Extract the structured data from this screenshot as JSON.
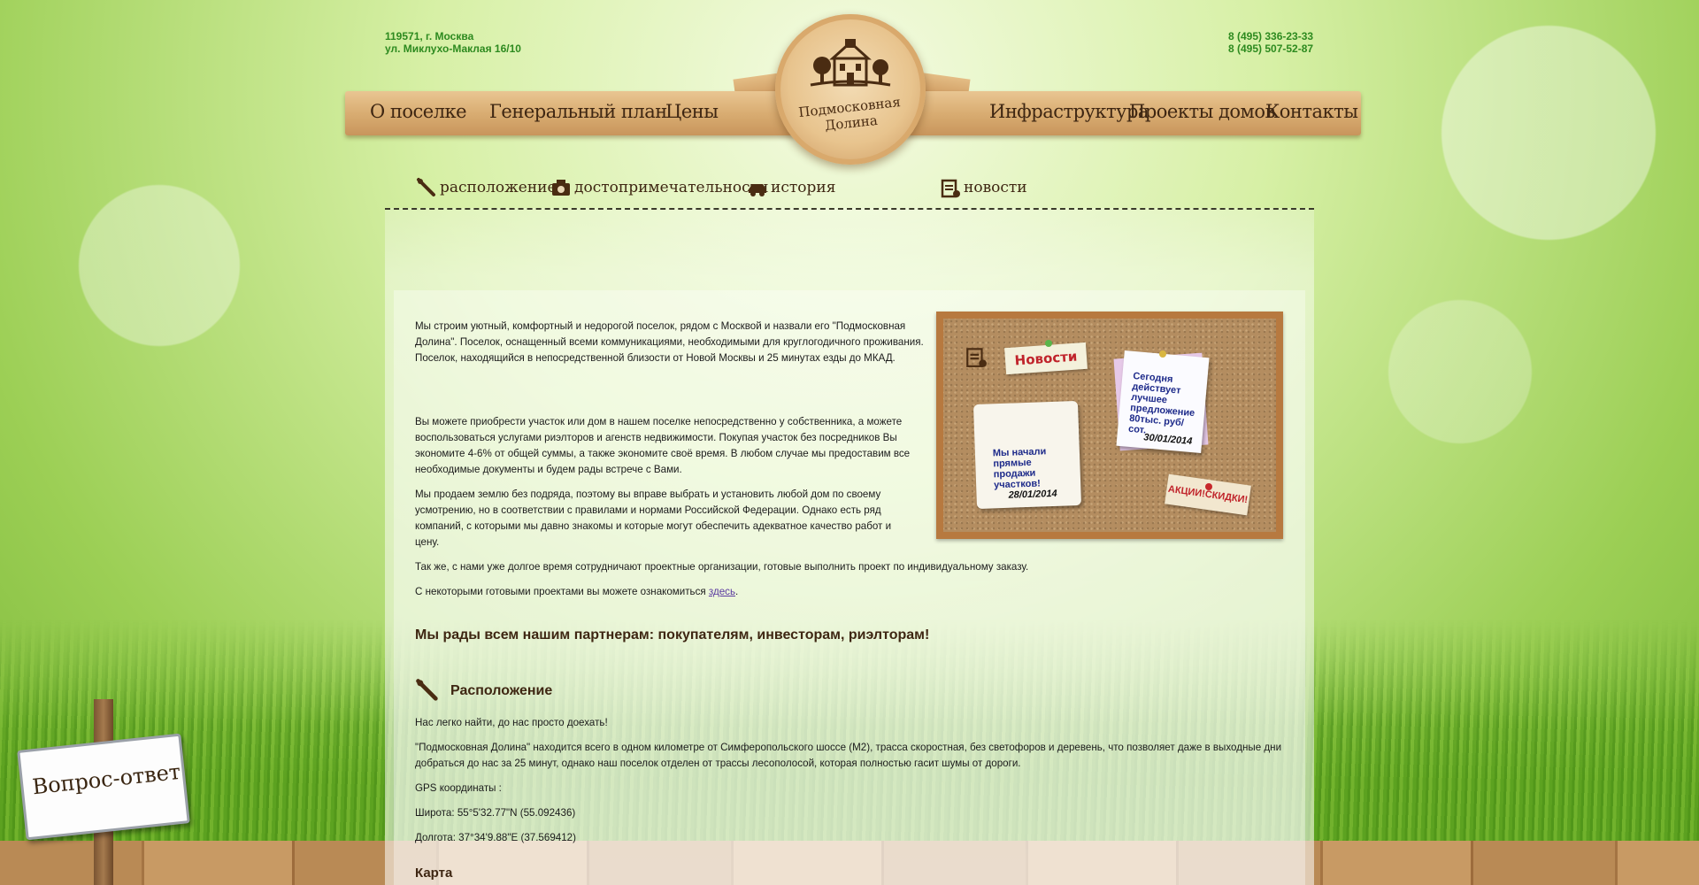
{
  "header": {
    "address_line1": "119571, г. Москва",
    "address_line2": "ул. Миклухо-Маклая 16/10",
    "phone1": "8 (495) 336-23-33",
    "phone2": "8 (495) 507-52-87",
    "logo_text": "Подмосковная Долина"
  },
  "menu": {
    "items": [
      "О поселке",
      "Генеральный план",
      "Цены",
      "Инфраструктура",
      "Проекты домов",
      "Контакты"
    ]
  },
  "submenu": {
    "items": [
      "расположение",
      "достопримечательности",
      "история",
      "новости"
    ]
  },
  "content": {
    "p1": "Мы строим уютный, комфортный и недорогой поселок, рядом с Москвой и назвали его \"Подмосковная Долина\". Поселок, оснащенный всеми коммуникациями, необходимыми для круглогодичного проживания. Поселок, находящийся в непосредственной близости от Новой Москвы и 25 минутах езды до МКАД.",
    "p2": "Вы можете приобрести участок или дом в нашем поселке непосредственно у собственника, а можете воспользоваться услугами риэлторов и агенств недвижимости. Покупая участок без посредников Вы экономите 4-6% от общей суммы, а также экономите своё время. В любом случае мы предоставим все необходимые документы и будем рады встрече с Вами.",
    "p3": "Мы продаем землю без подряда, поэтому вы вправе выбрать и установить любой дом по своему усмотрению, но в соответствии с правилами и нормами Российской Федерации. Однако есть ряд компаний, с которыми мы давно знакомы и которые могут обеспечить адекватное качество работ и цену.",
    "p4": "Так же, с нами уже долгое время сотрудничают проектные организации, готовые выполнить проект по индивидуальному заказу.",
    "p5_prefix": "С некоторыми готовыми проектами вы можете ознакомиться ",
    "p5_link": "здесь",
    "p5_suffix": ".",
    "partners": "Мы рады всем нашим партнерам: покупателям, инвесторам, риэлторам!",
    "location_title": "Расположение",
    "loc1": "Нас легко найти, до нас просто доехать!",
    "loc2": "\"Подмосковная Долина\" находится всего в одном километре от Симферопольского шоссе (М2), трасса скоростная, без светофоров и деревень, что позволяет даже в выходные дни добраться до нас за 25 минут, однако наш поселок отделен от трассы лесополосой, которая полностью гасит шумы от дороги.",
    "gps": "GPS координаты :",
    "lat": "Широта: 55°5'32.77\"N (55.092436)",
    "lon": "Долгота: 37°34'9.88\"E (37.569412)",
    "map_title": "Карта"
  },
  "board": {
    "news_label": "Новости",
    "note1_text": "Мы начали прямые продажи участков!",
    "note1_date": "28/01/2014",
    "note2_text": "Сегодня действует лучшее предложение 80тыс. руб/сот.",
    "note2_date": "30/01/2014",
    "note3_text": "АКЦИИ!СКИДКИ!"
  },
  "faq_sign": {
    "label": "Вопрос-ответ"
  },
  "colors": {
    "accent_green": "#2d8a1f",
    "wood": "#d9ad72",
    "text_brown": "#3e2612"
  }
}
